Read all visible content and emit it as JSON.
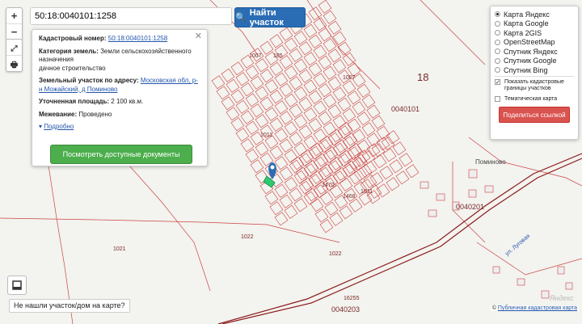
{
  "search": {
    "value": "50:18:0040101:1258",
    "button_label": "Найти участок"
  },
  "zoom": {
    "plus": "+",
    "minus": "−"
  },
  "info": {
    "cadastral_label": "Кадастровый номер:",
    "cadastral_value": "50:18:0040101:1258",
    "category_label": "Категория земель:",
    "category_value": "Земли сельскохозяйственного назначения",
    "category_use": "дачное строительство",
    "address_label": "Земельный участок по адресу:",
    "address_value": "Московская обл, р-н Можайский, д Поминово",
    "area_label": "Уточненная площадь:",
    "area_value": "2 100 кв.м.",
    "survey_label": "Межевание:",
    "survey_value": "Проведено",
    "more_label": "Подробно",
    "docs_button": "Посмотреть доступные документы",
    "close": "✕"
  },
  "layers": {
    "options": [
      {
        "label": "Карта Яндекс",
        "selected": true
      },
      {
        "label": "Карта Google",
        "selected": false
      },
      {
        "label": "Карта 2GIS",
        "selected": false
      },
      {
        "label": "OpenStreetMap",
        "selected": false
      },
      {
        "label": "Спутник Яндекс",
        "selected": false
      },
      {
        "label": "Спутник Google",
        "selected": false
      },
      {
        "label": "Спутник Bing",
        "selected": false
      }
    ],
    "show_cadastral": "Показать кадастровые границы участков",
    "thematic": "Тематическая карта",
    "share_button": "Поделиться ссылкой"
  },
  "not_found": "Не нашли участок/дом на карте?",
  "attribution": {
    "prefix": "©",
    "link": "Публичная кадастровая карта"
  },
  "yandex_mark": "Яндекс",
  "map_labels": {
    "l1007a": "1007",
    "l185": "185",
    "l1007b": "1007",
    "l18": "18",
    "l0040101": "0040101",
    "l1011a": "1011",
    "l1470": "1470",
    "l1468": "1468",
    "l1011b": "1011",
    "l0040201": "0040201",
    "l1022a": "1022",
    "l1021": "1021",
    "l1022b": "1022",
    "l16255": "16255",
    "l0040203": "0040203",
    "pominovo": "Поминово",
    "road": "ул. Луговая"
  },
  "colors": {
    "accent": "#2a6db5",
    "docs": "#4cae4c",
    "share": "#d9534f",
    "cadastral": "#c0392b"
  }
}
